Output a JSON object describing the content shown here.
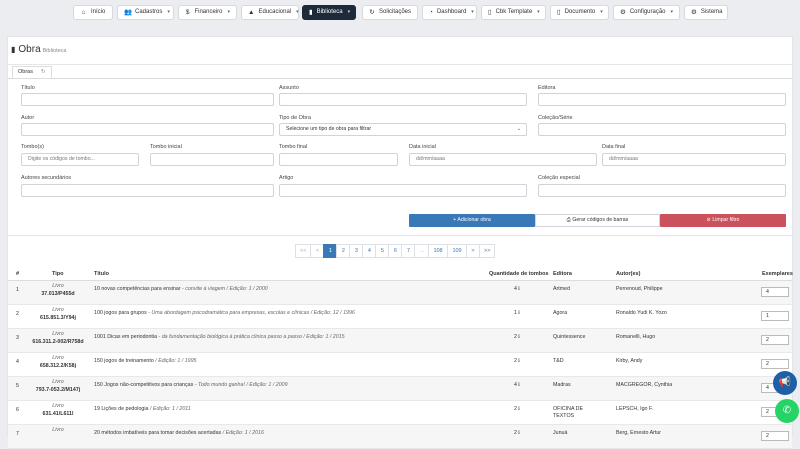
{
  "nav": [
    {
      "label": "Início",
      "icon": "home-icon",
      "glyph": "⌂",
      "caret": false,
      "active": false
    },
    {
      "label": "Cadastros",
      "icon": "users-icon",
      "glyph": "👥",
      "caret": true,
      "active": false
    },
    {
      "label": "Financeiro",
      "icon": "dollar-icon",
      "glyph": "$",
      "caret": true,
      "active": false
    },
    {
      "label": "Educacional",
      "icon": "graduation-cap-icon",
      "glyph": "▲",
      "caret": true,
      "active": false
    },
    {
      "label": "Biblioteca",
      "icon": "book-icon",
      "glyph": "▮",
      "caret": true,
      "active": true
    },
    {
      "label": "Solicitações",
      "icon": "refresh-icon",
      "glyph": "↻",
      "caret": false,
      "active": false
    },
    {
      "label": "Dashboard",
      "icon": "dashboard-icon",
      "glyph": "◔",
      "caret": true,
      "active": false
    },
    {
      "label": "Cbk Template",
      "icon": "file-icon",
      "glyph": "▯",
      "caret": true,
      "active": false
    },
    {
      "label": "Documento",
      "icon": "document-icon",
      "glyph": "▯",
      "caret": true,
      "active": false
    },
    {
      "label": "Configuração",
      "icon": "gear-icon",
      "glyph": "⚙",
      "caret": true,
      "active": false
    },
    {
      "label": "Sistema",
      "icon": "cogs-icon",
      "glyph": "⚙",
      "caret": false,
      "active": false
    }
  ],
  "page": {
    "title": "Obra",
    "subtitle": "Biblioteca",
    "tab": "Obras"
  },
  "form": {
    "titulo": "Título",
    "assunto": "Assunto",
    "editora": "Editora",
    "autor": "Autor",
    "tipo_obra": "Tipo de Obra",
    "tipo_obra_value": "Selecione um tipo de obra para filtrar",
    "colecao_serie": "Coleção/Série",
    "tombos": "Tombo(s)",
    "tombos_placeholder": "Digite os códigos de tombo...",
    "tombo_inicial": "Tombo inicial",
    "tombo_final": "Tombo final",
    "data_inicial": "Data inicial",
    "data_inicial_placeholder": "dd/mm/aaaa",
    "data_final": "Data final",
    "data_final_placeholder": "dd/mm/aaaa",
    "autores_secundarios": "Autores secundários",
    "artigo": "Artigo",
    "colecao_especial": "Coleção especial"
  },
  "buttons": {
    "add": "+ Adicionar obra",
    "barcode": "⎙ Gerar códigos de barras",
    "clear": "⊘ Limpar filtro"
  },
  "pagination": [
    "<<",
    "<",
    "1",
    "2",
    "3",
    "4",
    "5",
    "6",
    "7",
    "...",
    "108",
    "109",
    ">",
    ">>"
  ],
  "columns": {
    "num": "#",
    "tipo": "Tipo",
    "titulo": "Título",
    "qtd": "Quantidade de tombos",
    "editora": "Editora",
    "autores": "Autor(es)",
    "exemplares": "Exemplares"
  },
  "rows": [
    {
      "num": "1",
      "tipo": "Livro",
      "codigo": "37.013/P455d",
      "titulo": "10 novas competências para ensinar",
      "meta": " - convite à viagem / Edição: 1 / 2000",
      "qtd": "4",
      "editora": "Artmed",
      "editora2": "",
      "autor": "Perrenoud, Philippe",
      "ex": "4"
    },
    {
      "num": "2",
      "tipo": "Livro",
      "codigo": "615.851.3/Y94j",
      "titulo": "100 jogos para grupos",
      "meta": " - Uma abordagem psicodramática para empresas, escolas e clínicas / Edição: 12 / 1996",
      "qtd": "1",
      "editora": "Agora",
      "editora2": "",
      "autor": "Ronaldo Yudi K. Yozo",
      "ex": "1"
    },
    {
      "num": "3",
      "tipo": "Livro",
      "codigo": "616.311.2-002/R758d",
      "titulo": "1001 Dicas em periodontia",
      "meta": " - da fundamentação biológica à prática clínica passo a passo / Edição: 1 / 2015",
      "qtd": "2",
      "editora": "Quintessence",
      "editora2": "",
      "autor": "Romanelli, Hugo",
      "ex": "2"
    },
    {
      "num": "4",
      "tipo": "Livro",
      "codigo": "658.312.2/K58j",
      "titulo": "150 jogos de treinamento",
      "meta": " / Edição: 1 / 1995",
      "qtd": "2",
      "editora": "T&D",
      "editora2": "",
      "autor": "Kirby, Andy",
      "ex": "2"
    },
    {
      "num": "5",
      "tipo": "Livro",
      "codigo": "793.7-053.2/M147j",
      "titulo": "150 Jogos não-competitivos para crianças",
      "meta": " - Todo mundo ganha! / Edição: 1 / 2009",
      "qtd": "4",
      "editora": "Madras",
      "editora2": "",
      "autor": "MACGREGOR, Cynthia",
      "ex": "4"
    },
    {
      "num": "6",
      "tipo": "Livro",
      "codigo": "631.41/L611l",
      "titulo": "19 Lições de pedologia",
      "meta": " / Edição: 1 / 2011",
      "qtd": "2",
      "editora": "OFICINA DE",
      "editora2": "TEXTOS",
      "autor": "LEPSCH, Igo F.",
      "ex": "2"
    },
    {
      "num": "7",
      "tipo": "Livro",
      "codigo": "",
      "titulo": "20 métodos imbatíveis para tomar decisões acertadas",
      "meta": " / Edição: 1 / 2016",
      "qtd": "2",
      "editora": "Junuá",
      "editora2": "",
      "autor": "Berg, Ernesto Artur",
      "ex": "2"
    }
  ],
  "colors": {
    "active_nav": "#1c2a3a",
    "primary": "#3a79b8",
    "danger": "#c9525d",
    "whatsapp": "#25d366"
  }
}
